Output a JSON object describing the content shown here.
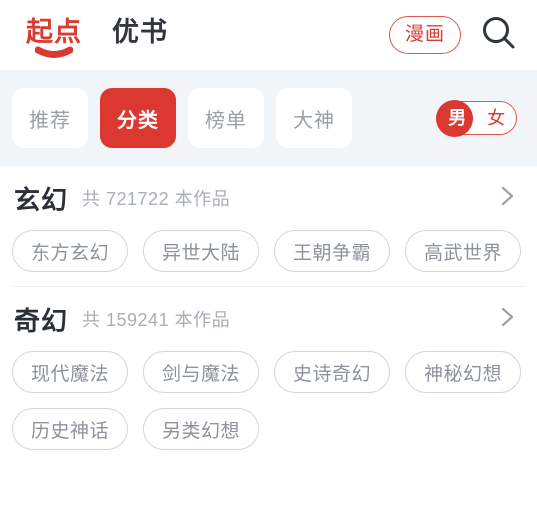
{
  "header": {
    "brand_tabs": [
      {
        "label": "起点",
        "active": true
      },
      {
        "label": "优书",
        "active": false
      }
    ],
    "comic_button": "漫画",
    "search_icon": "search-icon",
    "accent_color": "#dc3832"
  },
  "filter_bar": {
    "tabs": [
      {
        "label": "推荐",
        "active": false
      },
      {
        "label": "分类",
        "active": true
      },
      {
        "label": "榜单",
        "active": false
      },
      {
        "label": "大神",
        "active": false
      }
    ],
    "gender_toggle": {
      "male": "男",
      "female": "女",
      "selected": "男"
    },
    "background_color": "#f2f5f7"
  },
  "sections": [
    {
      "title": "玄幻",
      "count_text": "共 721722 本作品",
      "count": 721722,
      "chevron": "chevron-right-icon",
      "tags": [
        "东方玄幻",
        "异世大陆",
        "王朝争霸",
        "高武世界"
      ]
    },
    {
      "title": "奇幻",
      "count_text": "共 159241 本作品",
      "count": 159241,
      "chevron": "chevron-right-icon",
      "tags": [
        "现代魔法",
        "剑与魔法",
        "史诗奇幻",
        "神秘幻想",
        "历史神话",
        "另类幻想"
      ]
    }
  ]
}
